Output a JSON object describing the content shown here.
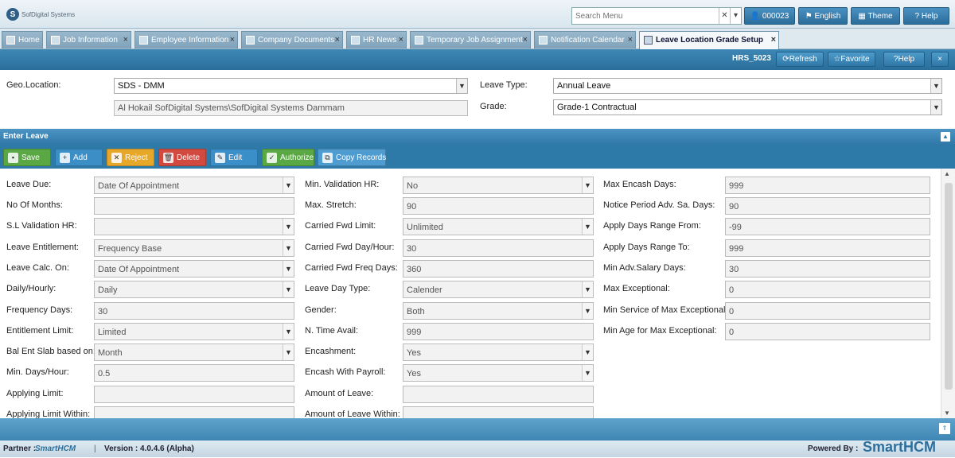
{
  "header": {
    "logo_text": "SofDigital Systems",
    "search_placeholder": "Search Menu",
    "buttons": {
      "user": "000023",
      "language": "English",
      "theme": "Theme",
      "help": "Help"
    }
  },
  "tabs": [
    {
      "label": "Home"
    },
    {
      "label": "Job Information"
    },
    {
      "label": "Employee Information"
    },
    {
      "label": "Company Documents"
    },
    {
      "label": "HR News"
    },
    {
      "label": "Temporary Job Assignment"
    },
    {
      "label": "Notification Calendar"
    },
    {
      "label": "Leave Location Grade Setup",
      "active": true
    }
  ],
  "actions": {
    "code": "HRS_5023",
    "refresh": "Refresh",
    "favorite": "Favorite",
    "help": "Help",
    "close": "×"
  },
  "filter": {
    "geo_label": "Geo.Location:",
    "geo_value": "SDS - DMM",
    "geo_path": "Al Hokail SofDigital Systems\\SofDigital Systems Dammam",
    "leave_type_label": "Leave Type:",
    "leave_type_value": "Annual Leave",
    "grade_label": "Grade:",
    "grade_value": "Grade-1 Contractual"
  },
  "panel": {
    "title": "Enter Leave"
  },
  "toolbar": {
    "save": "Save",
    "add": "Add",
    "reject": "Reject",
    "delete": "Delete",
    "edit": "Edit",
    "authorize": "Authorize",
    "copy": "Copy Records"
  },
  "form": {
    "col1": [
      {
        "label": "Leave Due:",
        "value": "Date Of Appointment",
        "type": "select"
      },
      {
        "label": "No Of Months:",
        "value": "",
        "type": "text"
      },
      {
        "label": "S.L Validation HR:",
        "value": "",
        "type": "select"
      },
      {
        "label": "Leave Entitlement:",
        "value": "Frequency Base",
        "type": "select"
      },
      {
        "label": "Leave Calc. On:",
        "value": "Date Of Appointment",
        "type": "select"
      },
      {
        "label": "Daily/Hourly:",
        "value": "Daily",
        "type": "select"
      },
      {
        "label": "Frequency Days:",
        "value": "30",
        "type": "text"
      },
      {
        "label": "Entitlement Limit:",
        "value": "Limited",
        "type": "select"
      },
      {
        "label": "Bal Ent Slab based on:",
        "value": "Month",
        "type": "select"
      },
      {
        "label": "Min. Days/Hour:",
        "value": "0.5",
        "type": "text"
      },
      {
        "label": "Applying Limit:",
        "value": "",
        "type": "text"
      },
      {
        "label": "Applying Limit Within:",
        "value": "",
        "type": "text"
      }
    ],
    "col2": [
      {
        "label": "Min. Validation HR:",
        "value": "No",
        "type": "select"
      },
      {
        "label": "Max. Stretch:",
        "value": "90",
        "type": "text"
      },
      {
        "label": "Carried Fwd Limit:",
        "value": "Unlimited",
        "type": "select"
      },
      {
        "label": "Carried Fwd Day/Hour:",
        "value": "30",
        "type": "text"
      },
      {
        "label": "Carried Fwd Freq Days:",
        "value": "360",
        "type": "text"
      },
      {
        "label": "Leave Day Type:",
        "value": "Calender",
        "type": "select"
      },
      {
        "label": "Gender:",
        "value": "Both",
        "type": "select"
      },
      {
        "label": "N. Time Avail:",
        "value": "999",
        "type": "text"
      },
      {
        "label": "Encashment:",
        "value": "Yes",
        "type": "select"
      },
      {
        "label": "Encash With Payroll:",
        "value": "Yes",
        "type": "select"
      },
      {
        "label": "Amount of Leave:",
        "value": "",
        "type": "text"
      },
      {
        "label": "Amount of Leave Within:",
        "value": "",
        "type": "text"
      }
    ],
    "col3": [
      {
        "label": "Max Encash Days:",
        "value": "999",
        "type": "text"
      },
      {
        "label": "Notice Period Adv. Sa. Days:",
        "value": "90",
        "type": "text"
      },
      {
        "label": "Apply Days Range From:",
        "value": "-99",
        "type": "text"
      },
      {
        "label": "Apply Days Range To:",
        "value": "999",
        "type": "text"
      },
      {
        "label": "Min Adv.Salary Days:",
        "value": "30",
        "type": "text"
      },
      {
        "label": "Max Exceptional:",
        "value": "0",
        "type": "text"
      },
      {
        "label": "Min Service of Max Exceptional:",
        "value": "0",
        "type": "text"
      },
      {
        "label": "Min Age for Max Exceptional:",
        "value": "0",
        "type": "text"
      }
    ]
  },
  "footer": {
    "partner_label": "Partner :",
    "partner_logo": "SmartHCM",
    "separator": "|",
    "version": "Version : 4.0.4.6 (Alpha)",
    "powered_label": "Powered By :",
    "brand": "SmartHCM"
  }
}
